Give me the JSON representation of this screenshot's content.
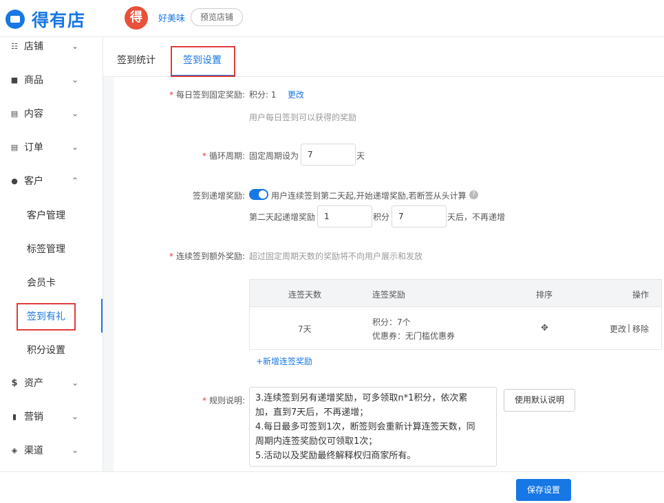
{
  "brand": {
    "name": "得有店",
    "icon": "store-icon",
    "accent": "#1677e5"
  },
  "shop": {
    "avatar_glyph": "得",
    "name": "好美味",
    "preview_label": "预览店铺"
  },
  "sidebar": {
    "items": [
      {
        "label": "店铺",
        "icon": "sliders-icon",
        "glyph": "☷",
        "expanded": false
      },
      {
        "label": "商品",
        "icon": "goods-icon",
        "glyph": "■",
        "expanded": false
      },
      {
        "label": "内容",
        "icon": "content-icon",
        "glyph": "▤",
        "expanded": false
      },
      {
        "label": "订单",
        "icon": "order-icon",
        "glyph": "▤",
        "expanded": false
      },
      {
        "label": "客户",
        "icon": "customers-icon",
        "glyph": "●",
        "expanded": true
      },
      {
        "label": "资产",
        "icon": "dollar-icon",
        "glyph": "$",
        "expanded": false
      },
      {
        "label": "营销",
        "icon": "bar-chart-icon",
        "glyph": "▮",
        "expanded": false
      },
      {
        "label": "渠道",
        "icon": "layers-icon",
        "glyph": "◈",
        "expanded": false
      }
    ],
    "customer_sub": [
      "客户管理",
      "标签管理",
      "会员卡",
      "签到有礼",
      "积分设置"
    ],
    "active_sub": "签到有礼"
  },
  "tabs": [
    {
      "label": "签到统计",
      "active": false
    },
    {
      "label": "签到设置",
      "active": true
    }
  ],
  "form": {
    "daily": {
      "label": "每日签到固定奖励:",
      "value_text": "积分: 1",
      "edit_link": "更改",
      "hint": "用户每日签到可以获得的奖励"
    },
    "cycle": {
      "label": "循环周期:",
      "prefix": "固定周期设为",
      "value": "7",
      "suffix": "天"
    },
    "increment": {
      "label": "签到递增奖励:",
      "enabled": true,
      "desc": "用户连续签到第二天起,开始递增奖励,若断签从头计算",
      "help": "?",
      "prefix": "第二天起递增奖励",
      "points": "1",
      "points_unit": "积分",
      "days": "7",
      "days_suffix": "天后，不再递增"
    },
    "extra": {
      "label": "连续签到额外奖励:",
      "hint": "超过固定周期天数的奖励将不向用户展示和发放",
      "columns": [
        "连签天数",
        "连签奖励",
        "排序",
        "操作"
      ],
      "rows": [
        {
          "days": "7天",
          "reward_points": "积分：7个",
          "reward_coupon": "优惠券：无门槛优惠券",
          "sort": "✥",
          "edit": "更改",
          "sep": "|",
          "remove": "移除"
        }
      ],
      "add_link": "+新增连签奖励"
    },
    "rules": {
      "label": "规则说明:",
      "lines": [
        "3.连续签到另有递增奖励，可多领取n*1积分，依次累",
        "加，直到7天后，不再递增；",
        "4.每日最多可签到1次，断签则会重新计算连签天数，同",
        "周期内连签奖励仅可领取1次；",
        "5.活动以及奖励最终解释权归商家所有。"
      ],
      "default_button": "使用默认说明"
    }
  },
  "footer": {
    "save_label": "保存设置"
  }
}
